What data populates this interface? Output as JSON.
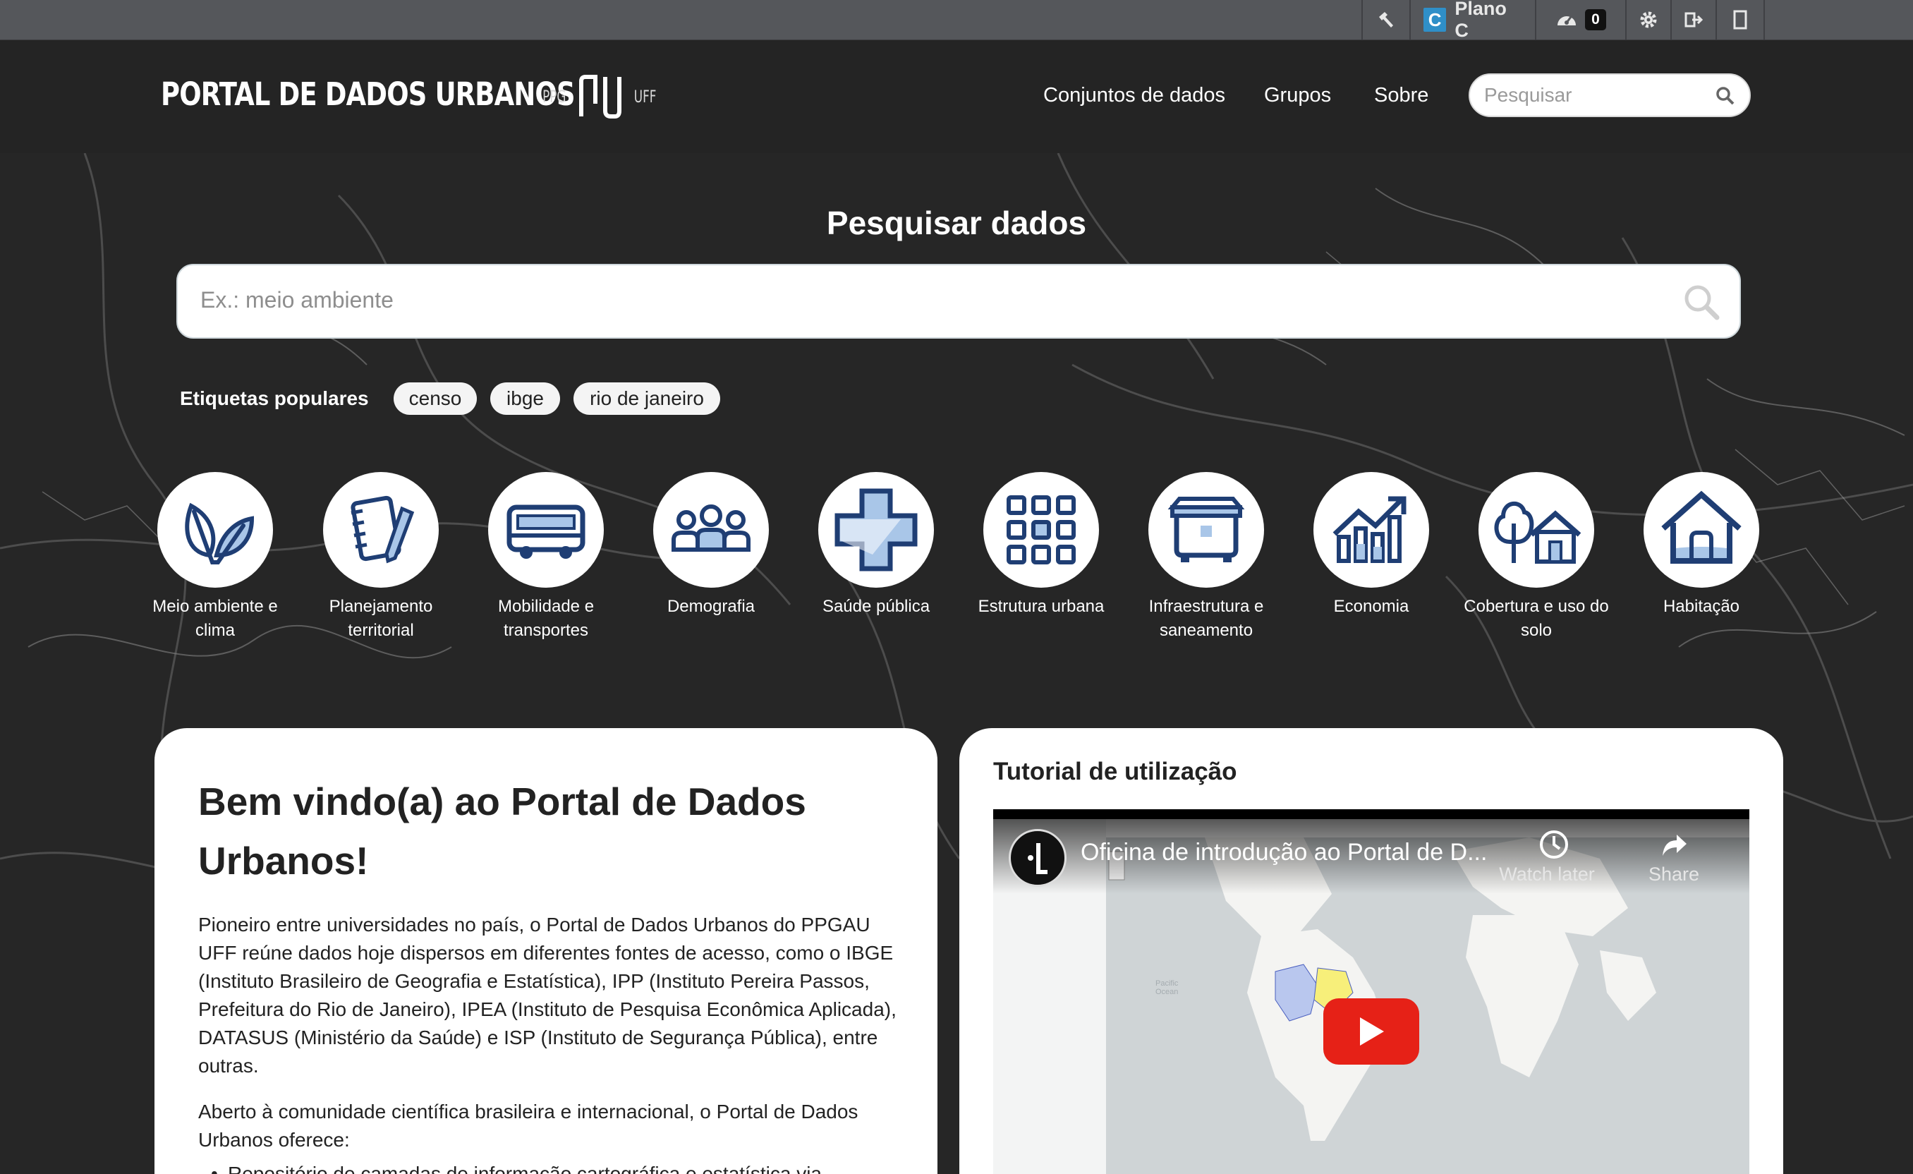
{
  "account": {
    "user_initial": "C",
    "user_name": "Plano C",
    "activity_count": "0"
  },
  "header": {
    "brand": "PORTAL DE DADOS URBANOS",
    "logo_left": "PPG",
    "logo_right": "UFF",
    "nav": [
      "Conjuntos de dados",
      "Grupos",
      "Sobre"
    ],
    "search_placeholder": "Pesquisar"
  },
  "hero": {
    "title": "Pesquisar dados",
    "search_placeholder": "Ex.: meio ambiente",
    "tags_label": "Etiquetas populares",
    "tags": [
      "censo",
      "ibge",
      "rio de janeiro"
    ]
  },
  "categories": [
    {
      "line1": "Meio ambiente e",
      "line2": "clima",
      "icon": "leaves-icon"
    },
    {
      "line1": "Planejamento",
      "line2": "territorial",
      "icon": "notebook-pencil-icon"
    },
    {
      "line1": "Mobilidade e",
      "line2": "transportes",
      "icon": "bus-icon"
    },
    {
      "line1": "Demografia",
      "line2": "",
      "icon": "people-icon"
    },
    {
      "line1": "Saúde pública",
      "line2": "",
      "icon": "health-cross-icon"
    },
    {
      "line1": "Estrutura urbana",
      "line2": "",
      "icon": "grid-icon"
    },
    {
      "line1": "Infraestrutura e",
      "line2": "saneamento",
      "icon": "dumpster-icon"
    },
    {
      "line1": "Economia",
      "line2": "",
      "icon": "growth-chart-icon"
    },
    {
      "line1": "Cobertura e uso do",
      "line2": "solo",
      "icon": "tree-house-icon"
    },
    {
      "line1": "Habitação",
      "line2": "",
      "icon": "house-icon"
    }
  ],
  "welcome": {
    "title_line1": "Bem vindo(a) ao Portal de Dados",
    "title_line2": "Urbanos!",
    "p1_lines": [
      "Pioneiro entre universidades no país, o Portal de Dados Urbanos do PPGAU",
      "UFF reúne dados hoje dispersos em diferentes fontes de acesso, como o IBGE",
      "(Instituto Brasileiro de Geografia e Estatística), IPP (Instituto Pereira Passos,",
      "Prefeitura do Rio de Janeiro), IPEA (Instituto de Pesquisa Econômica Aplicada),",
      "DATASUS (Ministério da Saúde) e ISP (Instituto de Segurança Pública), entre",
      "outras."
    ],
    "p2_lines": [
      "Aberto à comunidade científica brasileira e internacional, o Portal de Dados",
      "Urbanos oferece:"
    ],
    "li1": "Repositório de camadas de informação cartográfica e estatística via"
  },
  "tutorial": {
    "title": "Tutorial de utilização",
    "video_title": "Oficina de introdução ao Portal de D...",
    "watch_later": "Watch later",
    "share": "Share"
  },
  "colors": {
    "icon_navy": "#1f3e74",
    "icon_light_blue": "#a9c6e8",
    "youtube_red": "#e62117"
  }
}
